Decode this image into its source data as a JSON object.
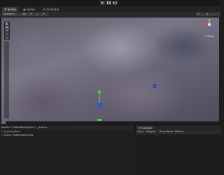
{
  "play_controls": {
    "play": "▶",
    "pause": "❚❚",
    "step": "▶❙"
  },
  "tabs": [
    {
      "label": "Scene",
      "active": true
    },
    {
      "label": "Game",
      "active": false
    },
    {
      "label": "Animator",
      "active": false
    }
  ],
  "scene_toolbar": {
    "shading": "Shaded",
    "mode_2d": "2D",
    "persp_label": "< Persp"
  },
  "tool_icons": [
    "hand-icon",
    "move-icon",
    "rotate-icon",
    "scale-icon",
    "rect-icon"
  ],
  "project": {
    "breadcrumb": "Assets > RotatableSkybox > _Scenes",
    "items": [
      "LightingData",
      "Scene_RotatableSkybox"
    ]
  },
  "console": {
    "tab_label": "Console",
    "buttons": [
      "Clear",
      "Collapse",
      "Error Pause",
      "Editor"
    ]
  },
  "colors": {
    "accent": "#2e5c8a",
    "panel": "#1f1f1f"
  }
}
